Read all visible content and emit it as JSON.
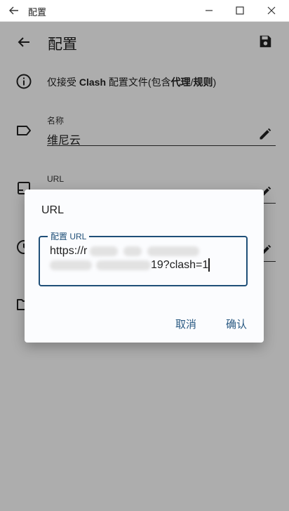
{
  "window": {
    "title": "配置"
  },
  "appbar": {
    "title": "配置"
  },
  "info": {
    "prefix": "仅接受 ",
    "bold1": "Clash",
    "middle": " 配置文件(包含",
    "bold2": "代理",
    "sep": "/",
    "bold3": "规则",
    "suffix": ")"
  },
  "name_field": {
    "label": "名称",
    "value": "维尼云"
  },
  "url_field": {
    "label": "URL"
  },
  "dialog": {
    "title": "URL",
    "field_label": "配置 URL",
    "input_line1": "https://r",
    "input_line2_end": "19?clash=1",
    "cancel": "取消",
    "confirm": "确认"
  },
  "colors": {
    "accent": "#1f4f78",
    "button_text": "#2a5a83",
    "scrim": "rgba(0,0,0,0.32)"
  }
}
